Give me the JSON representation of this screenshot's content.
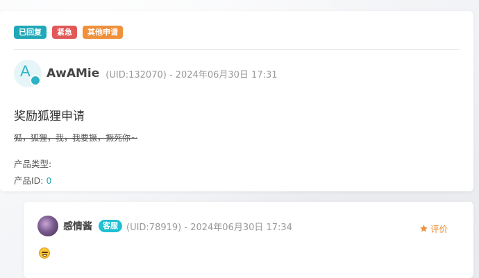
{
  "post": {
    "tags": [
      {
        "label": "已回复",
        "color": "#20a8b8"
      },
      {
        "label": "紧急",
        "color": "#e05858"
      },
      {
        "label": "其他申请",
        "color": "#f0903a"
      }
    ],
    "author": {
      "avatar_letter": "A",
      "name": "AwAMie",
      "meta": "(UID:132070) - 2024年06月30日 17:31"
    },
    "title": "奖励狐狸申请",
    "body": "狐，狐狸，我，我要撅，撅死你~",
    "product_type_label": "产品类型:",
    "product_type_value": "",
    "product_id_label": "产品ID: ",
    "product_id_value": "0"
  },
  "reply": {
    "author": {
      "name": "感情酱",
      "staff_tag": "客服",
      "meta": "(UID:78919) - 2024年06月30日 17:34"
    },
    "rate_label": "评价",
    "content_icon": "grinning-face-emoji"
  },
  "colors": {
    "accent": "#20a8b8",
    "urgent": "#e05858",
    "warning": "#f0903a",
    "staff": "#1fc0d3"
  }
}
